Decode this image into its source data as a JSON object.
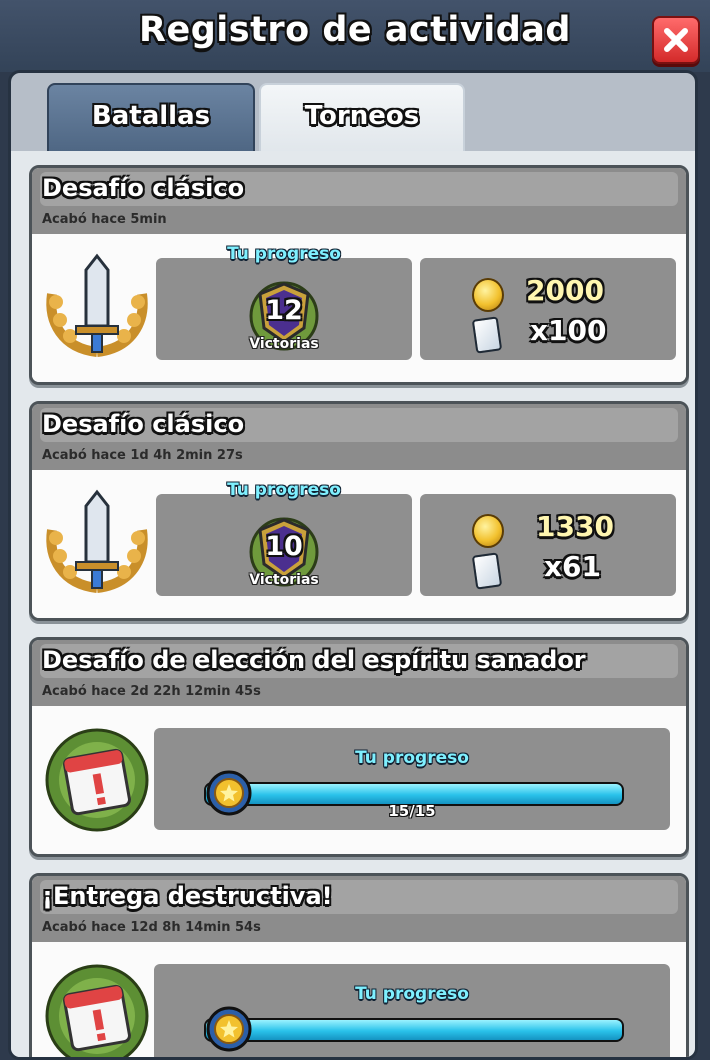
{
  "header": {
    "title": "Registro de actividad"
  },
  "tabs": [
    {
      "label": "Batallas",
      "active": false
    },
    {
      "label": "Torneos",
      "active": true
    }
  ],
  "entries": [
    {
      "title": "Desafío clásico",
      "ended": "Acabó hace 5min",
      "type": "wins",
      "progress_label": "Tu progreso",
      "wins": "12",
      "wins_label": "Victorias",
      "gold": "2000",
      "cards": "x100",
      "emblem_icon": "sword-laurel-icon"
    },
    {
      "title": "Desafío clásico",
      "ended": "Acabó hace 1d 4h 2min  27s",
      "type": "wins",
      "progress_label": "Tu progreso",
      "wins": "10",
      "wins_label": "Victorias",
      "gold": "1330",
      "cards": "x61",
      "emblem_icon": "sword-laurel-icon"
    },
    {
      "title": "Desafío de elección del espíritu sanador",
      "ended": "Acabó hace 2d 22h 12min  45s",
      "type": "progress",
      "progress_label": "Tu progreso",
      "progress_text": "15/15",
      "progress_fraction": 1.0,
      "emblem_icon": "calendar-laurel-icon"
    },
    {
      "title": "¡Entrega destructiva!",
      "ended": "Acabó hace 12d 8h 14min  54s",
      "type": "progress",
      "progress_label": "Tu progreso",
      "progress_fraction": 1.0,
      "emblem_icon": "calendar-laurel-icon"
    }
  ],
  "colors": {
    "accent": "#7ff0ff",
    "gold": "#f2c12e",
    "bar": "#29c2ea",
    "close": "#d42a2a"
  }
}
